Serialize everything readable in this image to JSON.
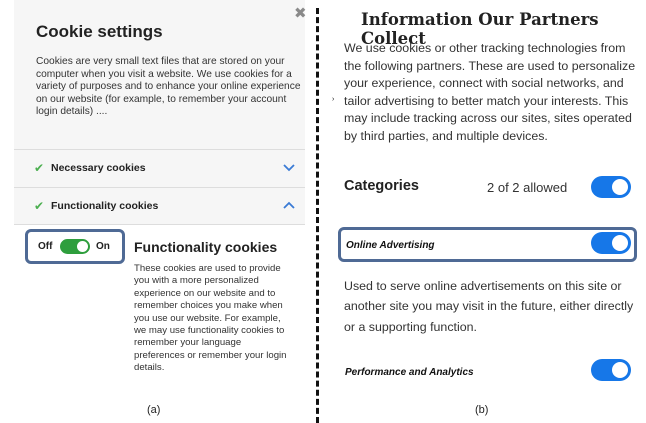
{
  "panel_a": {
    "close_symbol": "✖",
    "title": "Cookie settings",
    "description": "Cookies are very small text files that are stored on your computer when you visit a website. We use cookies for a variety of purposes and to enhance your online experience on our website (for example, to remember your account login details) ....",
    "necessary": {
      "check": "✔",
      "label": "Necessary cookies",
      "chevron": "down"
    },
    "functionality": {
      "check": "✔",
      "label": "Functionality cookies",
      "chevron": "up"
    },
    "toggle": {
      "off_label": "Off",
      "on_label": "On",
      "state": "on",
      "color": "#2e9e3d"
    },
    "detail_title": "Functionality cookies",
    "detail_text": "These cookies are used to provide you with a more personalized experience on our website and to remember choices you make when you use our website. For example, we may use functionality cookies to remember your language preferences or remember your login details.",
    "caption": "(a)"
  },
  "panel_b": {
    "title": "Information Our Partners Collect",
    "description": "We use cookies or other tracking technologies from the following partners. These are used to personalize your experience, connect with social networks, and tailor advertising to better match your interests. This may include tracking across our sites, sites operated by third parties, and multiple devices.",
    "categories_title": "Categories",
    "allowed_text": "2 of 2 allowed",
    "online_advertising": {
      "label": "Online Advertising",
      "state": "on"
    },
    "online_advertising_text": "Used to serve online advertisements on this site or another site you may visit in the future, either directly or a supporting function.",
    "performance": {
      "label": "Performance and Analytics",
      "state": "on"
    },
    "toggle_color": "#1677e8",
    "highlight_color": "#4f6a95",
    "caption": "(b)"
  },
  "divider_mark": "›"
}
